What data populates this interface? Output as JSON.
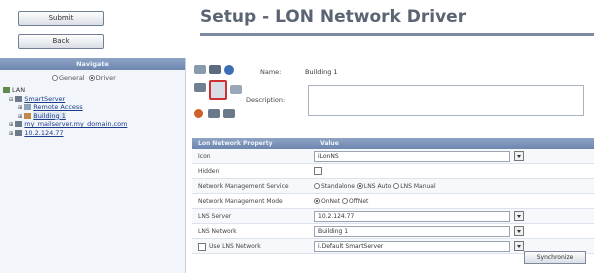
{
  "toolbar": {
    "submit_label": "Submit",
    "back_label": "Back"
  },
  "header": {
    "title": "Setup - LON Network Driver"
  },
  "navigate": {
    "heading": "Navigate",
    "radio_general": "General",
    "radio_driver": "Driver",
    "tree": [
      {
        "label": "LAN",
        "indent": 0
      },
      {
        "label": "SmartServer",
        "indent": 1
      },
      {
        "label": "Remote Access",
        "indent": 2
      },
      {
        "label": "Building 1",
        "indent": 2
      },
      {
        "label": "my_mailserver.my_domain.com",
        "indent": 1
      },
      {
        "label": "10.2.124.77",
        "indent": 1
      }
    ]
  },
  "properties": {
    "name_label": "Name:",
    "name_value": "Building 1",
    "description_label": "Description:",
    "description_value": ""
  },
  "grid": {
    "col_property": "Lon Network Property",
    "col_value": "Value",
    "icon_value": "iLonNS",
    "hidden_label": "Hidden",
    "nms_label": "Network Management Service",
    "nms_options": [
      "Standalone",
      "LNS Auto",
      "LNS Manual"
    ],
    "nmm_label": "Network Management Mode",
    "nmm_options": [
      "OnNet",
      "OffNet"
    ],
    "icon_label": "Icon",
    "lns_server_label": "LNS Server",
    "lns_server_value": "10.2.124.77",
    "lns_network_label": "LNS Network",
    "lns_network_value": "Building 1",
    "use_lns_label": "Use LNS Network",
    "use_lns_value": "i.Default SmartServer",
    "sync_label": "Synchronize"
  }
}
